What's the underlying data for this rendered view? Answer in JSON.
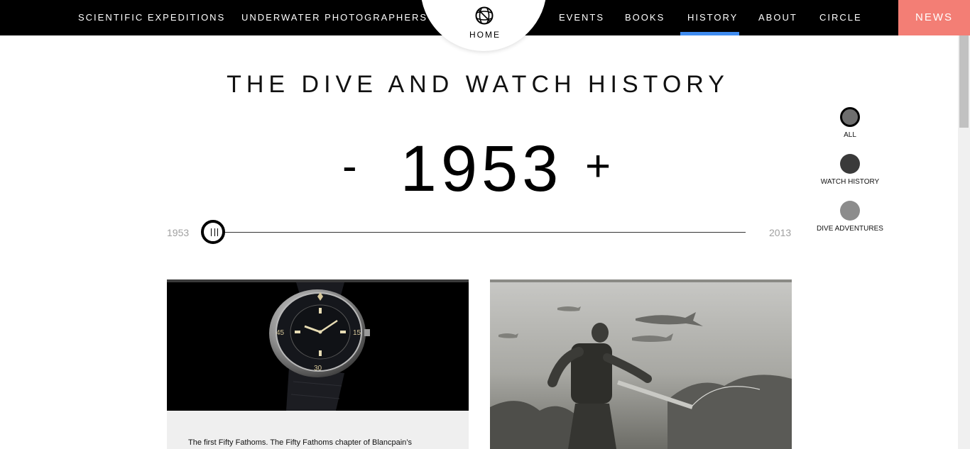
{
  "nav": {
    "left_links": [
      "SCIENTIFIC EXPEDITIONS",
      "UNDERWATER PHOTOGRAPHERS"
    ],
    "home_label": "HOME",
    "right_links": [
      "EVENTS",
      "BOOKS",
      "HISTORY",
      "ABOUT",
      "CIRCLE"
    ],
    "active_link": "HISTORY",
    "news_label": "NEWS",
    "home_icon": "globe-icon"
  },
  "colors": {
    "active_indicator": "#3f8cf0",
    "news_bg": "#f37e75",
    "filter_all": "#6e6e6e",
    "filter_watch": "#3a3a3a",
    "filter_dive": "#8c8c8c"
  },
  "page": {
    "title": "THE DIVE AND WATCH HISTORY"
  },
  "year_selector": {
    "minus_label": "-",
    "value": "1953",
    "plus_label": "+"
  },
  "timeline": {
    "min_label": "1953",
    "max_label": "2013",
    "position_fraction": 0
  },
  "filters": [
    {
      "label": "ALL",
      "selected": true
    },
    {
      "label": "WATCH HISTORY",
      "selected": false
    },
    {
      "label": "DIVE ADVENTURES",
      "selected": false
    }
  ],
  "cards": {
    "watch_card_text": "The first Fifty Fathoms. The Fifty Fathoms chapter of Blancpain’s"
  }
}
